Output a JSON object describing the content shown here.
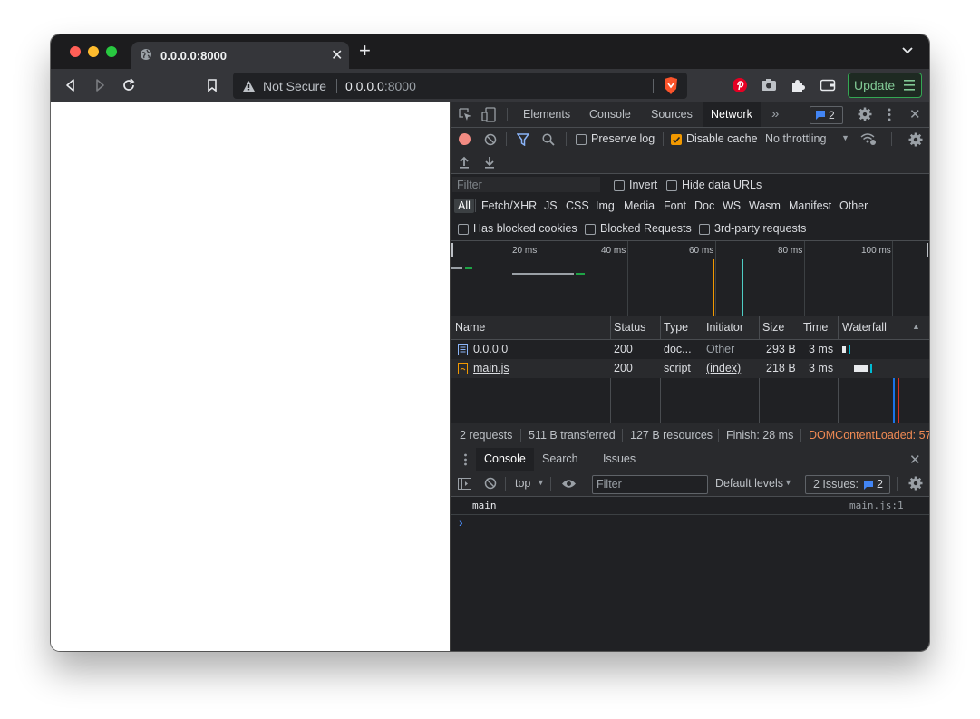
{
  "tab": {
    "title": "0.0.0.0:8000"
  },
  "omnibox": {
    "security": "Not Secure",
    "host": "0.0.0.0",
    "port": ":8000"
  },
  "toolbar": {
    "update_label": "Update"
  },
  "devtools": {
    "tabs": [
      "Elements",
      "Console",
      "Sources",
      "Network"
    ],
    "issues_count": "2",
    "network_toolbar": {
      "preserve_log": "Preserve log",
      "disable_cache": "Disable cache",
      "throttling": "No throttling"
    },
    "filter": {
      "placeholder": "Filter",
      "invert": "Invert",
      "hide_data_urls": "Hide data URLs"
    },
    "types": [
      "All",
      "Fetch/XHR",
      "JS",
      "CSS",
      "Img",
      "Media",
      "Font",
      "Doc",
      "WS",
      "Wasm",
      "Manifest",
      "Other"
    ],
    "blocked": {
      "cookies": "Has blocked cookies",
      "requests": "Blocked Requests",
      "third_party": "3rd-party requests"
    },
    "overview_ticks": [
      "20 ms",
      "40 ms",
      "60 ms",
      "80 ms",
      "100 ms"
    ],
    "table": {
      "headers": [
        "Name",
        "Status",
        "Type",
        "Initiator",
        "Size",
        "Time",
        "Waterfall"
      ],
      "rows": [
        {
          "name": "0.0.0.0",
          "status": "200",
          "type": "doc...",
          "initiator": "Other",
          "size": "293 B",
          "time": "3 ms"
        },
        {
          "name": "main.js",
          "status": "200",
          "type": "script",
          "initiator": "(index)",
          "size": "218 B",
          "time": "3 ms"
        }
      ]
    },
    "summary": {
      "requests": "2 requests",
      "transferred": "511 B transferred",
      "resources": "127 B resources",
      "finish": "Finish: 28 ms",
      "dcl": "DOMContentLoaded: 57"
    },
    "drawer": {
      "tabs": [
        "Console",
        "Search",
        "Issues"
      ],
      "context": "top",
      "filter_placeholder": "Filter",
      "levels": "Default levels",
      "issues_label": "2 Issues:",
      "issues_count": "2"
    },
    "console": {
      "message": "main",
      "source": "main.js:1",
      "prompt": "›"
    }
  }
}
